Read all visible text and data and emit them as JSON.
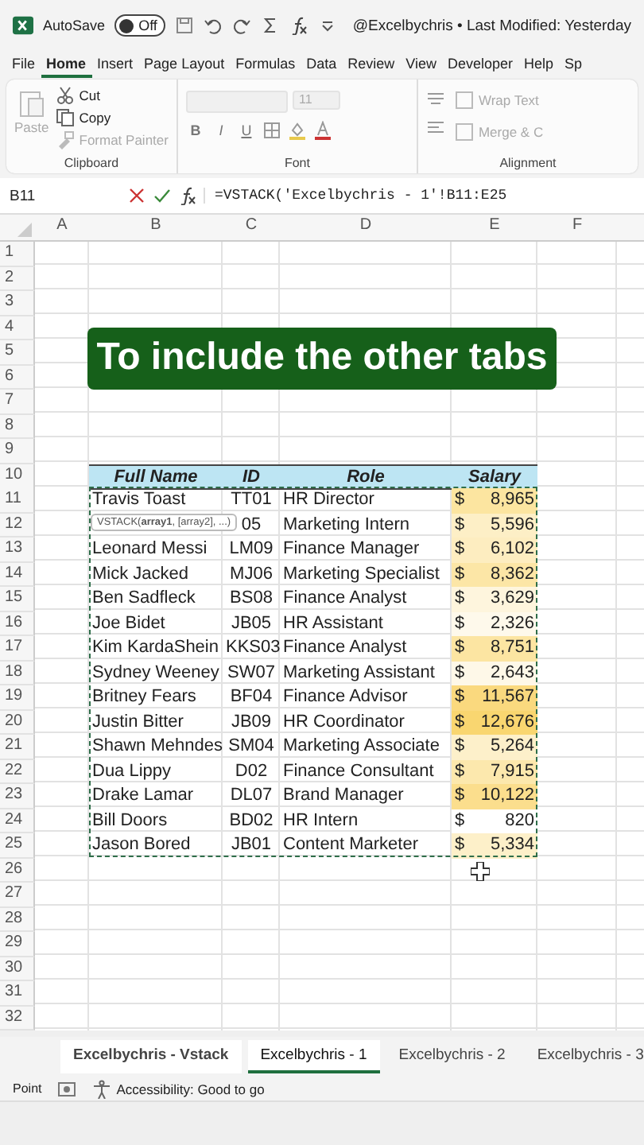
{
  "window": {
    "title": "@Excelbychris • Last Modified: Yesterday",
    "autosave": {
      "label": "AutoSave",
      "state_text": "Off",
      "on": false
    }
  },
  "menu_tabs": [
    {
      "label": "File",
      "selected": false
    },
    {
      "label": "Home",
      "selected": true
    },
    {
      "label": "Insert",
      "selected": false
    },
    {
      "label": "Page Layout",
      "selected": false
    },
    {
      "label": "Formulas",
      "selected": false
    },
    {
      "label": "Data",
      "selected": false
    },
    {
      "label": "Review",
      "selected": false
    },
    {
      "label": "View",
      "selected": false
    },
    {
      "label": "Developer",
      "selected": false
    },
    {
      "label": "Help",
      "selected": false
    },
    {
      "label": "Sp",
      "selected": false
    }
  ],
  "ribbon": {
    "clipboard": {
      "label": "Clipboard",
      "items": [
        {
          "label": "Paste",
          "disabled": true
        },
        {
          "label": "Cut",
          "disabled": false
        },
        {
          "label": "Copy",
          "disabled": false
        },
        {
          "label": "Format Painter",
          "disabled": true
        }
      ]
    },
    "font": {
      "label": "Font",
      "size": "11",
      "buttons": [
        "B",
        "I",
        "U"
      ]
    },
    "alignment": {
      "label": "Alignment",
      "items": [
        {
          "label": "Wrap Text"
        },
        {
          "label": "Merge & C"
        }
      ]
    }
  },
  "formula_bar": {
    "name_box": "B11",
    "formula": "=VSTACK('Excelbychris - 1'!B11:E25"
  },
  "sheet": {
    "columns": [
      "A",
      "B",
      "C",
      "D",
      "E",
      "F"
    ],
    "rows": [
      {
        "number": "1",
        "kind": "empty"
      },
      {
        "number": "2",
        "kind": "empty"
      },
      {
        "number": "3",
        "kind": "empty"
      },
      {
        "number": "4",
        "kind": "empty"
      },
      {
        "number": "5",
        "kind": "empty"
      },
      {
        "number": "6",
        "kind": "empty"
      },
      {
        "number": "7",
        "kind": "empty"
      },
      {
        "number": "8",
        "kind": "empty"
      },
      {
        "number": "9",
        "kind": "empty"
      },
      {
        "number": "10",
        "kind": "header",
        "cells": [
          "Full Name",
          "ID",
          "Role",
          "Salary"
        ]
      },
      {
        "number": "11",
        "kind": "data",
        "name": "Travis Toast",
        "id": "TT01",
        "role": "HR Director",
        "currency": "$",
        "salary": "8,965",
        "color": "#fce5a0"
      },
      {
        "number": "12",
        "kind": "data",
        "id": "05",
        "role": "Marketing Intern",
        "currency": "$",
        "salary": "5,596",
        "color": "#fdefc6"
      },
      {
        "number": "13",
        "kind": "data",
        "name": "Leonard Messi",
        "id": "LM09",
        "role": "Finance Manager",
        "currency": "$",
        "salary": "6,102",
        "color": "#fdedc0"
      },
      {
        "number": "14",
        "kind": "data",
        "name": "Mick Jacked",
        "id": "MJ06",
        "role": "Marketing Specialist",
        "currency": "$",
        "salary": "8,362",
        "color": "#fce6a6"
      },
      {
        "number": "15",
        "kind": "data",
        "name": "Ben Sadfleck",
        "id": "BS08",
        "role": "Finance Analyst",
        "currency": "$",
        "salary": "3,629",
        "color": "#fef5dd"
      },
      {
        "number": "16",
        "kind": "data",
        "name": "Joe Bidet",
        "id": "JB05",
        "role": "HR Assistant",
        "currency": "$",
        "salary": "2,326",
        "color": "#fef9eb"
      },
      {
        "number": "17",
        "kind": "data",
        "name": "Kim KardaShein",
        "id": "KKS03",
        "role": "Finance Analyst",
        "currency": "$",
        "salary": "8,751",
        "color": "#fce5a2"
      },
      {
        "number": "18",
        "kind": "data",
        "name": "Sydney Weeney",
        "id": "SW07",
        "role": "Marketing Assistant",
        "currency": "$",
        "salary": "2,643",
        "color": "#fef8e8"
      },
      {
        "number": "19",
        "kind": "data",
        "name": "Britney Fears",
        "id": "BF04",
        "role": "Finance Advisor",
        "currency": "$",
        "salary": "11,567",
        "color": "#fad97e"
      },
      {
        "number": "20",
        "kind": "data",
        "name": "Justin Bitter",
        "id": "JB09",
        "role": "HR Coordinator",
        "currency": "$",
        "salary": "12,676",
        "color": "#f9d670"
      },
      {
        "number": "21",
        "kind": "data",
        "name": "Shawn Mehndes",
        "id": "SM04",
        "role": "Marketing Associate",
        "currency": "$",
        "salary": "5,264",
        "color": "#fdf0ca"
      },
      {
        "number": "22",
        "kind": "data",
        "name": "Dua Lippy",
        "id": "D02",
        "role": "Finance Consultant",
        "currency": "$",
        "salary": "7,915",
        "color": "#fce8ad"
      },
      {
        "number": "23",
        "kind": "data",
        "name": "Drake Lamar",
        "id": "DL07",
        "role": "Brand Manager",
        "currency": "$",
        "salary": "10,122",
        "color": "#fbde8d"
      },
      {
        "number": "24",
        "kind": "data",
        "name": "Bill Doors",
        "id": "BD02",
        "role": "HR Intern",
        "currency": "$",
        "salary": "820",
        "color": "#ffffff"
      },
      {
        "number": "25",
        "kind": "data",
        "name": "Jason Bored",
        "id": "JB01",
        "role": "Content Marketer",
        "currency": "$",
        "salary": "5,334",
        "color": "#fdf0c9"
      },
      {
        "number": "26",
        "kind": "empty"
      },
      {
        "number": "27",
        "kind": "empty"
      },
      {
        "number": "28",
        "kind": "empty"
      },
      {
        "number": "29",
        "kind": "empty"
      },
      {
        "number": "30",
        "kind": "empty"
      },
      {
        "number": "31",
        "kind": "empty"
      },
      {
        "number": "32",
        "kind": "empty"
      }
    ],
    "banner": "To include the other tabs",
    "tooltip": "VSTACK(**array1**, [array2], ...)"
  },
  "sheet_tabs": [
    {
      "label": "Excelbychris - Vstack",
      "selected": false
    },
    {
      "label": "Excelbychris - 1",
      "selected": true
    },
    {
      "label": "Excelbychris - 2",
      "selected": false
    },
    {
      "label": "Excelbychris - 3",
      "selected": false
    }
  ],
  "status_bar": {
    "mode": "Point",
    "accessibility": "Accessibility: Good to go"
  }
}
